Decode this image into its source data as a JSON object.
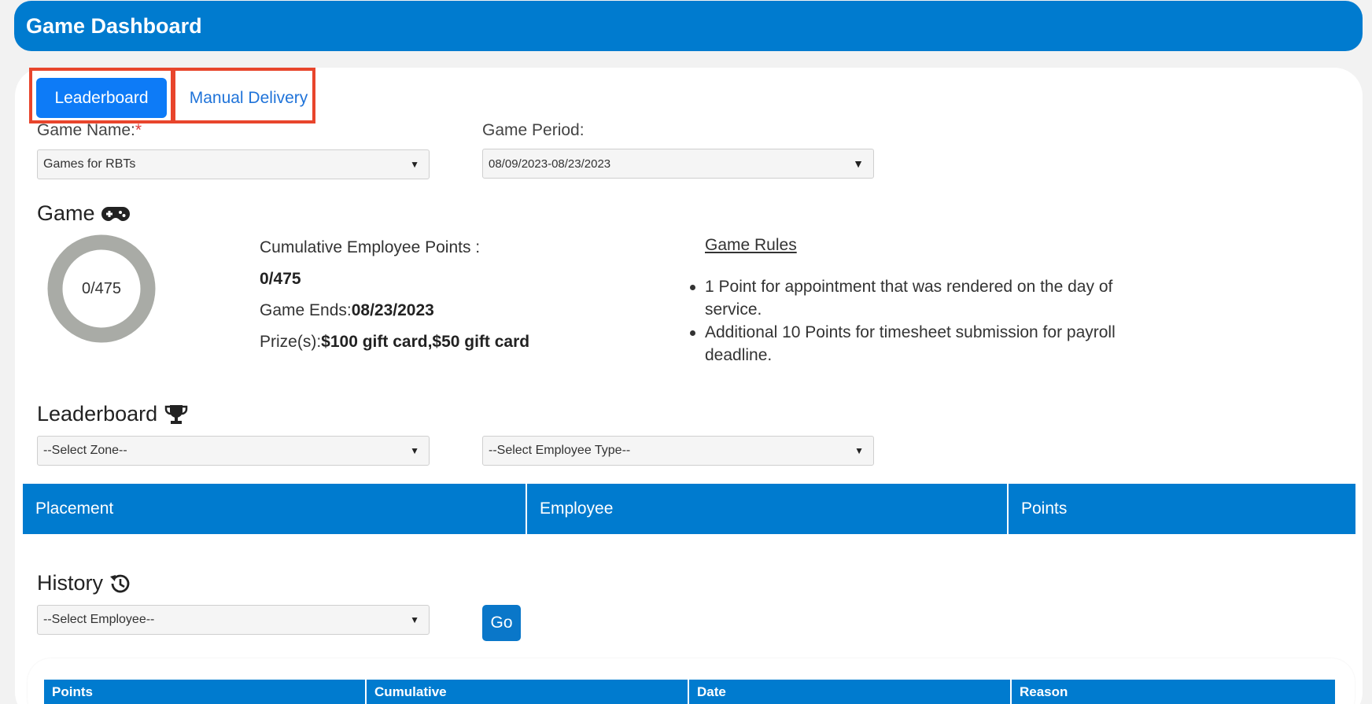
{
  "header": {
    "title": "Game Dashboard"
  },
  "tabs": {
    "leaderboard": "Leaderboard",
    "manual_delivery": "Manual Delivery"
  },
  "filters": {
    "game_name_label": "Game Name:",
    "game_name_required": "*",
    "game_name_value": "Games for RBTs",
    "game_period_label": "Game Period:",
    "game_period_value": "08/09/2023-08/23/2023"
  },
  "game": {
    "heading": "Game",
    "progress_label": "0/475",
    "progress_fraction": 0,
    "cumulative_label": "Cumulative Employee Points :",
    "cumulative_value": "0/475",
    "ends_label": "Game Ends:",
    "ends_value": "08/23/2023",
    "prizes_label": "Prize(s):",
    "prizes_value": "$100 gift card,$50 gift card",
    "rules_title": "Game Rules",
    "rules": [
      "1 Point for appointment that was rendered on the day of service.",
      "Additional 10 Points for timesheet submission for payroll deadline."
    ]
  },
  "leaderboard": {
    "heading": "Leaderboard",
    "zone_placeholder": "--Select Zone--",
    "employee_type_placeholder": "--Select Employee Type--",
    "columns": [
      "Placement",
      "Employee",
      "Points"
    ]
  },
  "history": {
    "heading": "History",
    "employee_placeholder": "--Select Employee--",
    "go_label": "Go",
    "columns": [
      "Points",
      "Cumulative",
      "Date",
      "Reason"
    ]
  },
  "colors": {
    "primary": "#007bcf",
    "tab_active": "#0d7bf7",
    "highlight": "#e8452c",
    "donut_track": "#a9aba6"
  }
}
